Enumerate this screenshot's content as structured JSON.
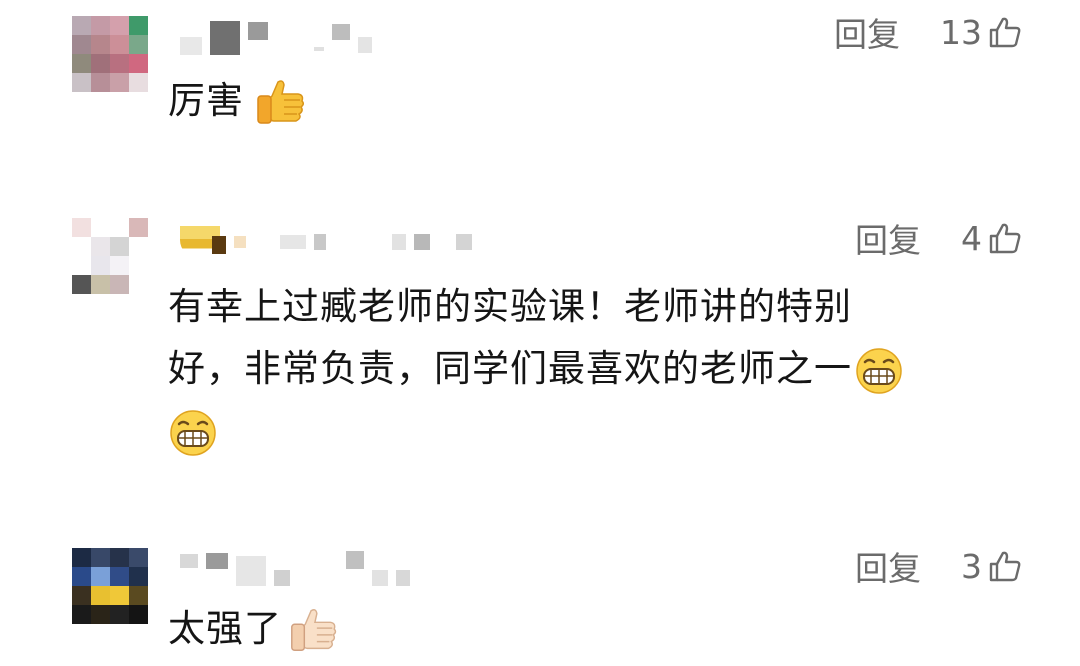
{
  "comments": [
    {
      "reply_label": "回复",
      "likes": "13",
      "text": "厉害",
      "emoji": "thumbs-up-yellow"
    },
    {
      "reply_label": "回复",
      "likes": "4",
      "text_line1": "有幸上过臧老师的实验课！老师讲的特别",
      "text_line2": "好，非常负责，同学们最喜欢的老师之一",
      "emoji": "grinning-face"
    },
    {
      "reply_label": "回复",
      "likes": "3",
      "text": "太强了",
      "emoji": "thumbs-up-light"
    }
  ],
  "colors": {
    "action_text": "#6b6b6b",
    "body_text": "#151515"
  }
}
